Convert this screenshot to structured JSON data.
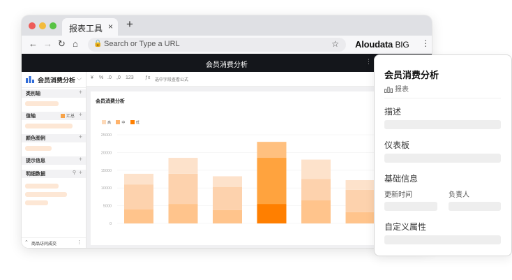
{
  "browser": {
    "tab_title": "报表工具",
    "close_glyph": "×",
    "new_tab_glyph": "+",
    "url_placeholder": "Search or Type a URL",
    "brand": "Aloudata",
    "brand_suffix": "BIG"
  },
  "app": {
    "title": "会员消费分析"
  },
  "sidebar": {
    "report_name": "会员消费分析",
    "sections": [
      "类别轴",
      "值轴",
      "颜色图例",
      "提示信息",
      "明细数据"
    ],
    "sum_label": "汇总",
    "footer_label": "商品访问成交"
  },
  "toolbar": {
    "hint": "选中字段查看公式"
  },
  "chart_card": {
    "title": "会员消费分析"
  },
  "chart_data": {
    "type": "bar",
    "stacked": true,
    "title": "会员消费分析",
    "categories": [
      "",
      "",
      "",
      "",
      "",
      ""
    ],
    "series": [
      {
        "name": "高",
        "values": [
          3000,
          4500,
          3000,
          4500,
          5500,
          2700
        ],
        "color": "#fdd9b8"
      },
      {
        "name": "中",
        "values": [
          7000,
          8500,
          6500,
          13000,
          6000,
          6300
        ],
        "color": "#ffb36b"
      },
      {
        "name": "低",
        "values": [
          4000,
          5500,
          3800,
          5500,
          6500,
          3200
        ],
        "color": "#ff7f00"
      }
    ],
    "yticks": [
      0,
      5000,
      10000,
      15000,
      20000,
      25000
    ],
    "ylim": [
      0,
      25000
    ],
    "highlight_index": 3,
    "legend_position": "top-left",
    "grid": true
  },
  "panel": {
    "title": "会员消费分析",
    "type_label": "报表",
    "desc_label": "描述",
    "dashboard_label": "仪表板",
    "basic_label": "基础信息",
    "updated_label": "更新时间",
    "owner_label": "负责人",
    "custom_label": "自定义属性"
  },
  "colors": {
    "accent": "#ff7f00",
    "light": "#fde7d5",
    "dark_bar": "#14161b"
  }
}
